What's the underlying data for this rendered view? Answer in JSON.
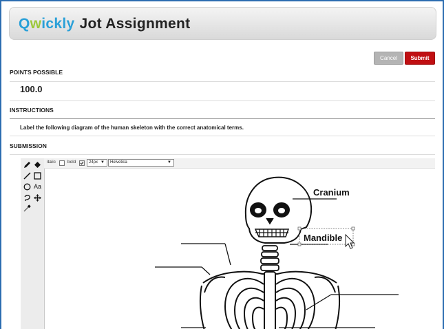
{
  "header": {
    "brand_q": "Q",
    "brand_w": "w",
    "brand_rest": "ickly",
    "title": "Jot Assignment"
  },
  "actions": {
    "cancel": "Cancel",
    "submit": "Submit"
  },
  "points": {
    "label": "POINTS POSSIBLE",
    "value": "100.0"
  },
  "instructions": {
    "label": "INSTRUCTIONS",
    "text": "Label the following diagram of the human skeleton with the correct anatomical terms."
  },
  "submission": {
    "label": "SUBMISSION"
  },
  "options": {
    "italic": "italic",
    "bold": "bold",
    "font_size": "24px",
    "font_family": "Helvetica",
    "italic_checked": false,
    "bold_checked": true
  },
  "tools": {
    "text_tool": "Aa"
  },
  "canvas": {
    "labels": [
      "Cranium",
      "Mandible"
    ]
  },
  "colors": {
    "brand_blue": "#2aa0d8",
    "brand_green": "#9dc83b",
    "submit_red": "#c00f12",
    "frame_blue": "#2c6db0"
  },
  "icons": [
    "pencil-icon",
    "fill-icon",
    "line-icon",
    "rectangle-icon",
    "ellipse-icon",
    "text-icon",
    "lasso-icon",
    "move-icon",
    "eyedropper-icon",
    "cursor-icon"
  ]
}
